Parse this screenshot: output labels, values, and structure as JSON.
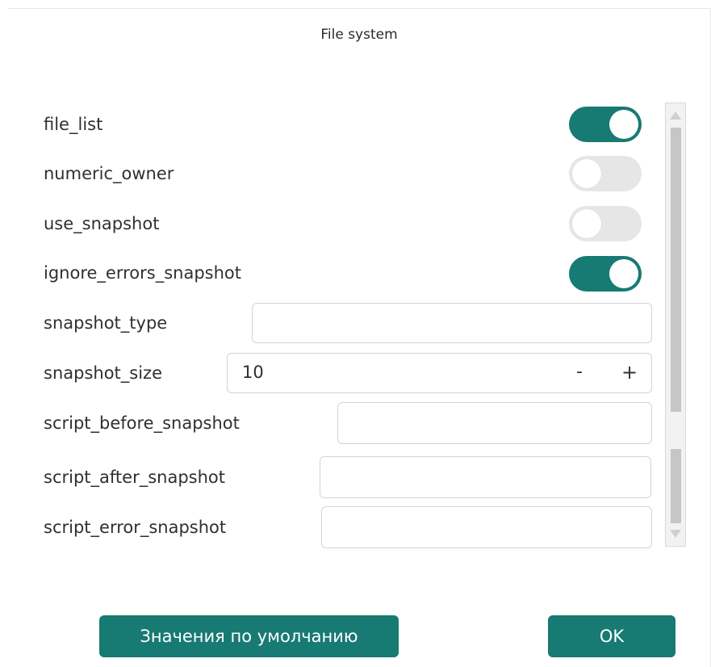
{
  "dialog": {
    "title": "File system"
  },
  "settings": {
    "file_list": {
      "label": "file_list",
      "enabled": true
    },
    "numeric_owner": {
      "label": "numeric_owner",
      "enabled": false
    },
    "use_snapshot": {
      "label": "use_snapshot",
      "enabled": false
    },
    "ignore_errors_snapshot": {
      "label": "ignore_errors_snapshot",
      "enabled": true
    },
    "snapshot_type": {
      "label": "snapshot_type",
      "value": ""
    },
    "snapshot_size": {
      "label": "snapshot_size",
      "value": "10",
      "decrement": "-",
      "increment": "+"
    },
    "script_before_snapshot": {
      "label": "script_before_snapshot",
      "value": ""
    },
    "script_after_snapshot": {
      "label": "script_after_snapshot",
      "value": ""
    },
    "script_error_snapshot": {
      "label": "script_error_snapshot",
      "value": ""
    }
  },
  "buttons": {
    "defaults_label": "Значения по умолчанию",
    "ok_label": "OK"
  },
  "colors": {
    "accent": "#177a73",
    "toggle_off": "#e6e6e6"
  }
}
